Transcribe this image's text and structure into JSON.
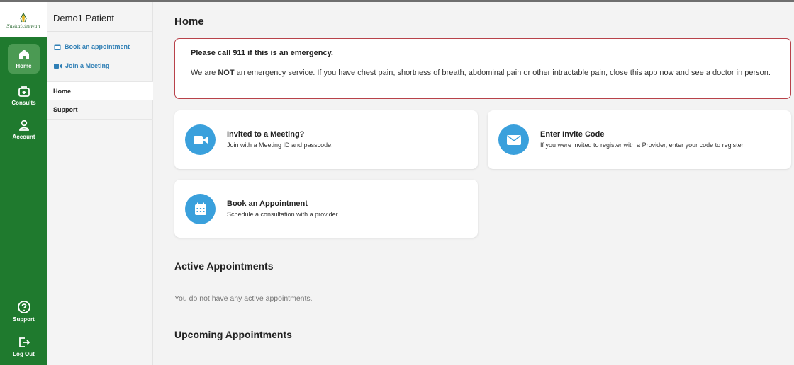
{
  "brand": {
    "logo_text": "Saskatchewan"
  },
  "rail": {
    "items": [
      {
        "label": "Home",
        "icon": "home-icon"
      },
      {
        "label": "Consults",
        "icon": "medical-bag-icon"
      },
      {
        "label": "Account",
        "icon": "person-icon"
      },
      {
        "label": "Support",
        "icon": "help-circle-icon"
      },
      {
        "label": "Log Out",
        "icon": "logout-icon"
      }
    ],
    "active_color": "#4b9a53",
    "background_color": "#1f7a2e"
  },
  "subnav": {
    "patient_name": "Demo1 Patient",
    "quick_links": [
      {
        "label": "Book an appointment",
        "icon": "calendar-icon"
      },
      {
        "label": "Join a Meeting",
        "icon": "video-icon"
      }
    ],
    "items": [
      {
        "label": "Home"
      },
      {
        "label": "Support"
      }
    ]
  },
  "main": {
    "title": "Home",
    "alert": {
      "title": "Please call 911 if this is an emergency.",
      "body_prefix": "We are ",
      "body_bold": "NOT",
      "body_suffix": " an emergency service. If you have chest pain, shortness of breath, abdominal pain or other intractable pain, close this app now and see a doctor in person.",
      "border_color": "#b8424a"
    },
    "cards": [
      {
        "title": "Invited to a Meeting?",
        "subtitle": "Join with a Meeting ID and passcode.",
        "icon": "video-camera-icon"
      },
      {
        "title": "Enter Invite Code",
        "subtitle": "If you were invited to register with a Provider, enter your code to register",
        "icon": "envelope-icon"
      },
      {
        "title": "Book an Appointment",
        "subtitle": "Schedule a consultation with a provider.",
        "icon": "calendar-icon"
      }
    ],
    "icon_color": "#3aa0dc",
    "active_appointments": {
      "title": "Active Appointments",
      "empty_text": "You do not have any active appointments."
    },
    "upcoming_appointments": {
      "title": "Upcoming Appointments"
    }
  }
}
